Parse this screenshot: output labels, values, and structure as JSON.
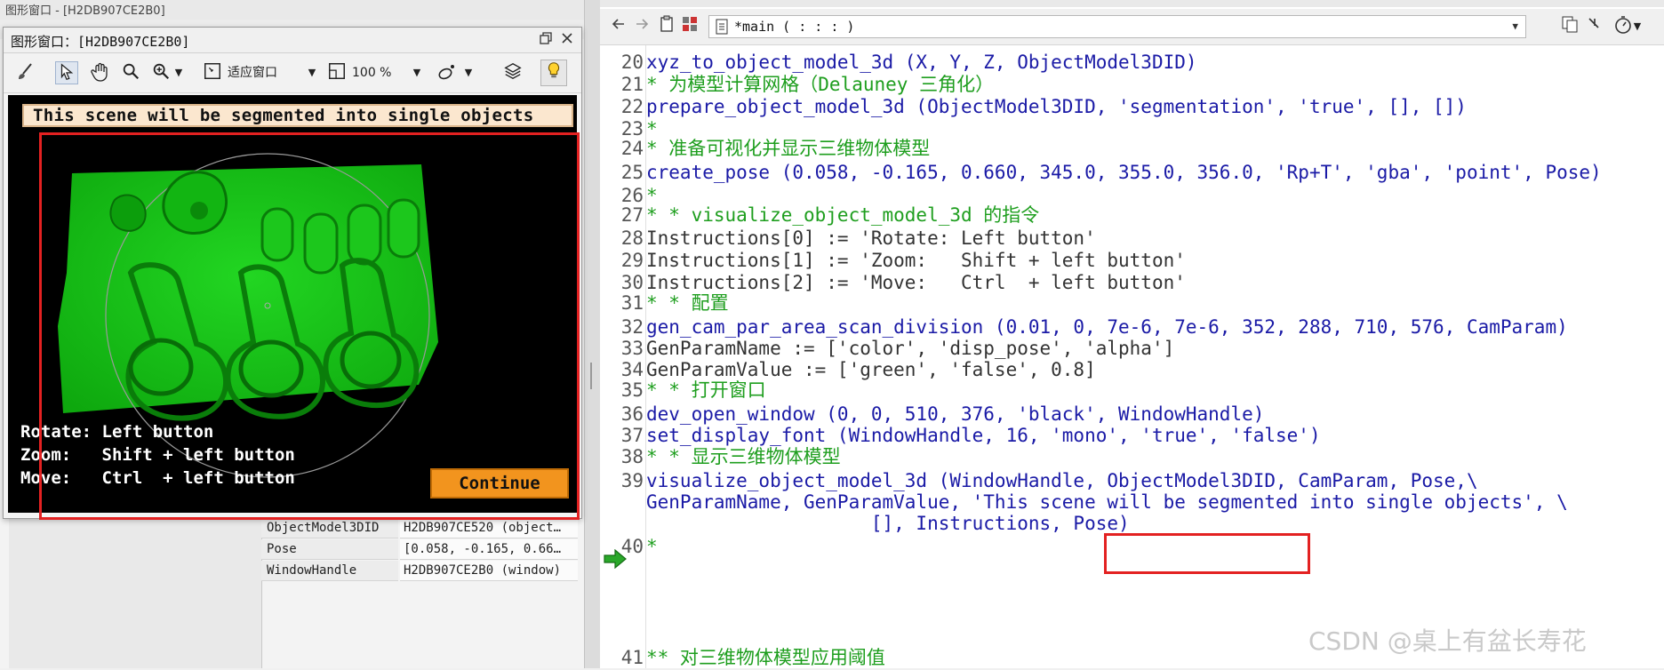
{
  "bg": {
    "topbar_text": "图形窗口 - [H2DB907CE2B0]"
  },
  "graphics_window": {
    "title": "图形窗口：[H2DB907CE2B0]",
    "toolbar": {
      "fit_window_label": "适应窗口",
      "zoom_label": "100 %"
    },
    "canvas": {
      "banner": "This scene will be segmented into single objects",
      "instructions": [
        "Rotate: Left button",
        "Zoom:   Shift + left button",
        "Move:   Ctrl  + left button"
      ],
      "continue_label": "Continue"
    }
  },
  "variables": [
    {
      "name": "ObjectModel3DID",
      "value": "H2DB907CE520 (object…"
    },
    {
      "name": "Pose",
      "value": "[0.058, -0.165, 0.66…"
    },
    {
      "name": "WindowHandle",
      "value": "H2DB907CE2B0 (window)"
    }
  ],
  "editor": {
    "procedure": "*main ( : : : )",
    "lines": [
      {
        "n": "20",
        "kind": "op",
        "text": "xyz_to_object_model_3d (X, Y, Z, ObjectModel3DID)"
      },
      {
        "n": "21",
        "kind": "cm",
        "text": "* 为模型计算网格（Delauney 三角化）"
      },
      {
        "n": "22",
        "kind": "op",
        "text": "prepare_object_model_3d (ObjectModel3DID, 'segmentation', 'true', [], [])"
      },
      {
        "n": "23",
        "kind": "cm",
        "text": "*"
      },
      {
        "n": "24",
        "kind": "cm",
        "text": "* 准备可视化并显示三维物体模型"
      },
      {
        "n": "25",
        "kind": "op",
        "text": "create_pose (0.058, -0.165, 0.660, 345.0, 355.0, 356.0, 'Rp+T', 'gba', 'point', Pose)"
      },
      {
        "n": "26",
        "kind": "cm",
        "text": "*"
      },
      {
        "n": "27",
        "kind": "cm",
        "text": "* * visualize_object_model_3d 的指令"
      },
      {
        "n": "28",
        "kind": "as",
        "text": "Instructions[0] := 'Rotate: Left button'"
      },
      {
        "n": "29",
        "kind": "as",
        "text": "Instructions[1] := 'Zoom:   Shift + left button'"
      },
      {
        "n": "30",
        "kind": "as",
        "text": "Instructions[2] := 'Move:   Ctrl  + left button'"
      },
      {
        "n": "31",
        "kind": "cm",
        "text": "* * 配置"
      },
      {
        "n": "32",
        "kind": "op",
        "text": "gen_cam_par_area_scan_division (0.01, 0, 7e-6, 7e-6, 352, 288, 710, 576, CamParam)"
      },
      {
        "n": "33",
        "kind": "as",
        "text": "GenParamName := ['color', 'disp_pose', 'alpha']"
      },
      {
        "n": "34",
        "kind": "as",
        "text": "GenParamValue := ['green', 'false', 0.8]"
      },
      {
        "n": "35",
        "kind": "cm",
        "text": "* * 打开窗口"
      },
      {
        "n": "36",
        "kind": "op",
        "text": "dev_open_window (0, 0, 510, 376, 'black', WindowHandle)"
      },
      {
        "n": "37",
        "kind": "op",
        "text": "set_display_font (WindowHandle, 16, 'mono', 'true', 'false')"
      },
      {
        "n": "38",
        "kind": "cm",
        "text": "* * 显示三维物体模型"
      },
      {
        "n": "39",
        "kind": "op",
        "text": "visualize_object_model_3d (WindowHandle, ObjectModel3DID, CamParam, Pose,\\"
      },
      {
        "n": "",
        "kind": "op",
        "text": "GenParamName, GenParamValue, 'This scene will be segmented into single objects', \\"
      },
      {
        "n": "",
        "kind": "op",
        "text": "                    [], Instructions, Pose)"
      },
      {
        "n": "40",
        "kind": "cm",
        "text": "*"
      },
      {
        "n": "41",
        "kind": "cm",
        "text": "** 对三维物体模型应用阈值"
      }
    ]
  },
  "watermark": "CSDN @桌上有盆长寿花"
}
